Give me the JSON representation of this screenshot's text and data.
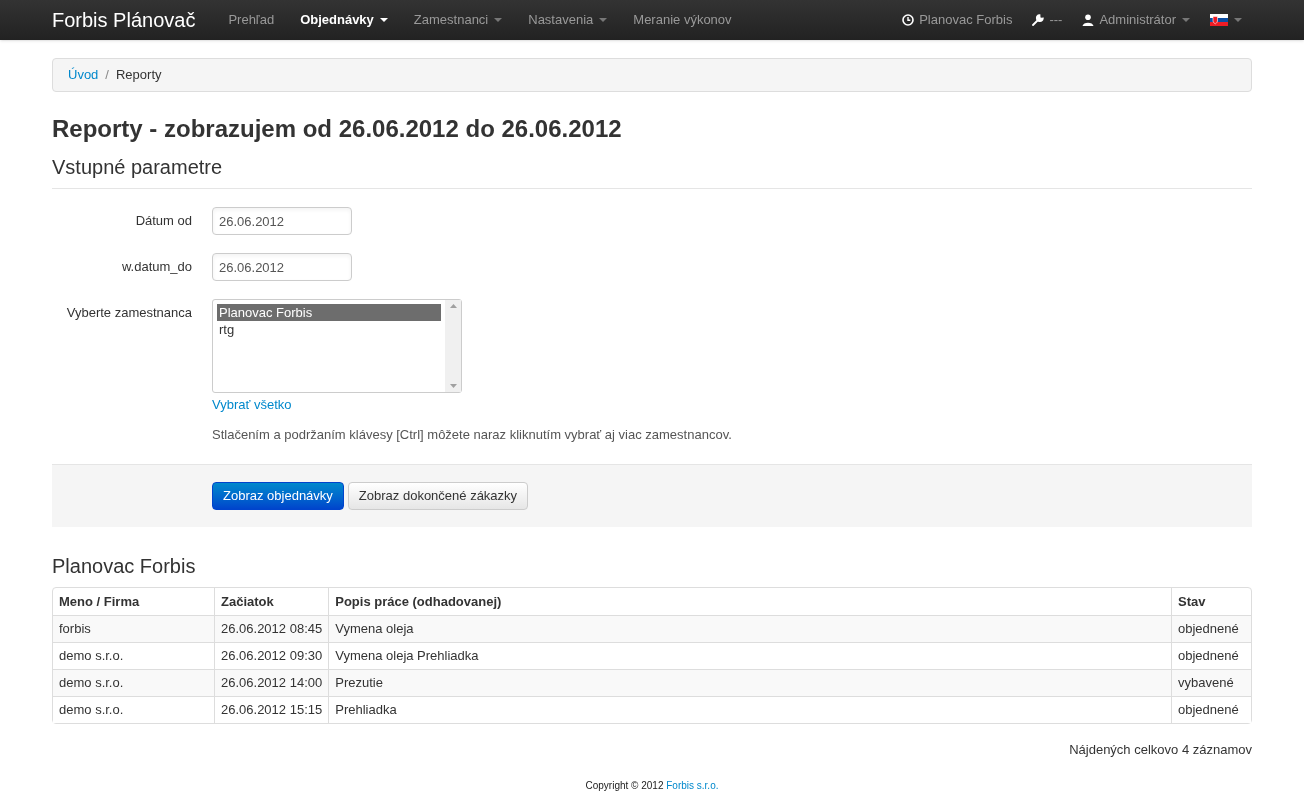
{
  "navbar": {
    "brand": "Forbis Plánovač",
    "items": [
      {
        "label": "Prehľad",
        "selected": false,
        "dropdown": false
      },
      {
        "label": "Objednávky",
        "selected": true,
        "dropdown": true
      },
      {
        "label": "Zamestnanci",
        "selected": false,
        "dropdown": true
      },
      {
        "label": "Nastavenia",
        "selected": false,
        "dropdown": true
      },
      {
        "label": "Meranie výkonov",
        "selected": false,
        "dropdown": false
      }
    ],
    "right": [
      {
        "kind": "clock",
        "label": "Planovac Forbis",
        "dropdown": false
      },
      {
        "kind": "wrench",
        "label": "---",
        "dropdown": false
      },
      {
        "kind": "user",
        "label": "Administrátor",
        "dropdown": true
      },
      {
        "kind": "flag",
        "dropdown": true
      }
    ]
  },
  "breadcrumb": [
    {
      "label": "Úvod",
      "link": true
    },
    {
      "label": "Reporty",
      "link": false
    }
  ],
  "breadcrumb_separator": "/",
  "title": "Reporty - zobrazujem od 26.06.2012 do 26.06.2012",
  "form": {
    "heading": "Vstupné parametre",
    "date_from": {
      "label": "Dátum od",
      "value": "26.06.2012"
    },
    "date_to": {
      "label": "w.datum_do",
      "value": "26.06.2012"
    },
    "employees": {
      "label": "Vyberte zamestnanca",
      "options": [
        {
          "label": "Planovac Forbis",
          "selected": true
        },
        {
          "label": "rtg",
          "selected": false
        }
      ],
      "select_all": "Vybrať všetko",
      "help": "Stlačením a podržaním klávesy [Ctrl] môžete naraz kliknutím vybrať aj viac zamestnancov."
    },
    "buttons": [
      {
        "label": "Zobraz objednávky",
        "kind": "primary"
      },
      {
        "label": "Zobraz dokončené zákazky",
        "kind": "default"
      }
    ]
  },
  "results": {
    "heading": "Planovac Forbis",
    "columns": [
      "Meno / Firma",
      "Začiatok",
      "Popis práce (odhadovanej)",
      "Stav"
    ],
    "rows": [
      [
        "forbis",
        "26.06.2012 08:45",
        "Vymena oleja",
        "objednené"
      ],
      [
        "demo s.r.o.",
        "26.06.2012 09:30",
        "Vymena oleja Prehliadka",
        "objednené"
      ],
      [
        "demo s.r.o.",
        "26.06.2012 14:00",
        "Prezutie",
        "vybavené"
      ],
      [
        "demo s.r.o.",
        "26.06.2012 15:15",
        "Prehliadka",
        "objednené"
      ]
    ],
    "count": "Nájdených celkovo 4 záznamov"
  },
  "footer": {
    "text": "Copyright © 2012 ",
    "link": "Forbis s.r.o."
  }
}
